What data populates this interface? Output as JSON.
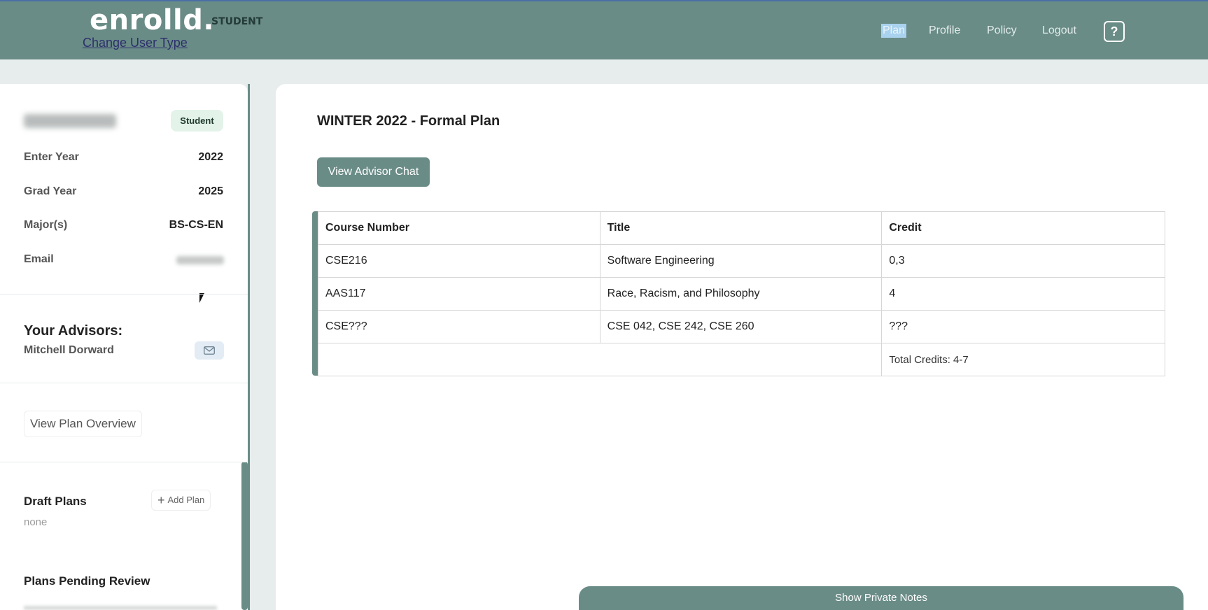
{
  "header": {
    "logo": "enrolld.",
    "user_type": "STUDENT",
    "change_user_type": "Change User Type",
    "nav": [
      "Plan",
      "Profile",
      "Policy",
      "Logout"
    ],
    "help": "?"
  },
  "profile": {
    "badge": "Student",
    "fields": [
      {
        "label": "Enter Year",
        "value": "2022"
      },
      {
        "label": "Grad Year",
        "value": "2025"
      },
      {
        "label": "Major(s)",
        "value": "BS-CS-EN"
      },
      {
        "label": "Email",
        "value": ""
      }
    ]
  },
  "advisors": {
    "title": "Your Advisors:",
    "name": "Mitchell Dorward"
  },
  "sidebar": {
    "view_plan_overview": "View Plan Overview",
    "draft_plans_title": "Draft Plans",
    "add_plan": "Add Plan",
    "draft_plans_empty": "none",
    "pending_title": "Plans Pending Review"
  },
  "plan": {
    "title": "WINTER 2022 - Formal Plan",
    "chat_button": "View Advisor Chat",
    "columns": [
      "Course Number",
      "Title",
      "Credit"
    ],
    "rows": [
      [
        "CSE216",
        "Software Engineering",
        "0,3"
      ],
      [
        "AAS117",
        "Race, Racism, and Philosophy",
        "4"
      ],
      [
        "CSE???",
        "CSE 042, CSE 242, CSE 260",
        "???"
      ]
    ],
    "total": "Total Credits: 4-7"
  },
  "notes": {
    "label": "Show Private Notes"
  },
  "colors": {
    "brand": "#6a8c87",
    "badge_bg": "#e3f3ea"
  }
}
